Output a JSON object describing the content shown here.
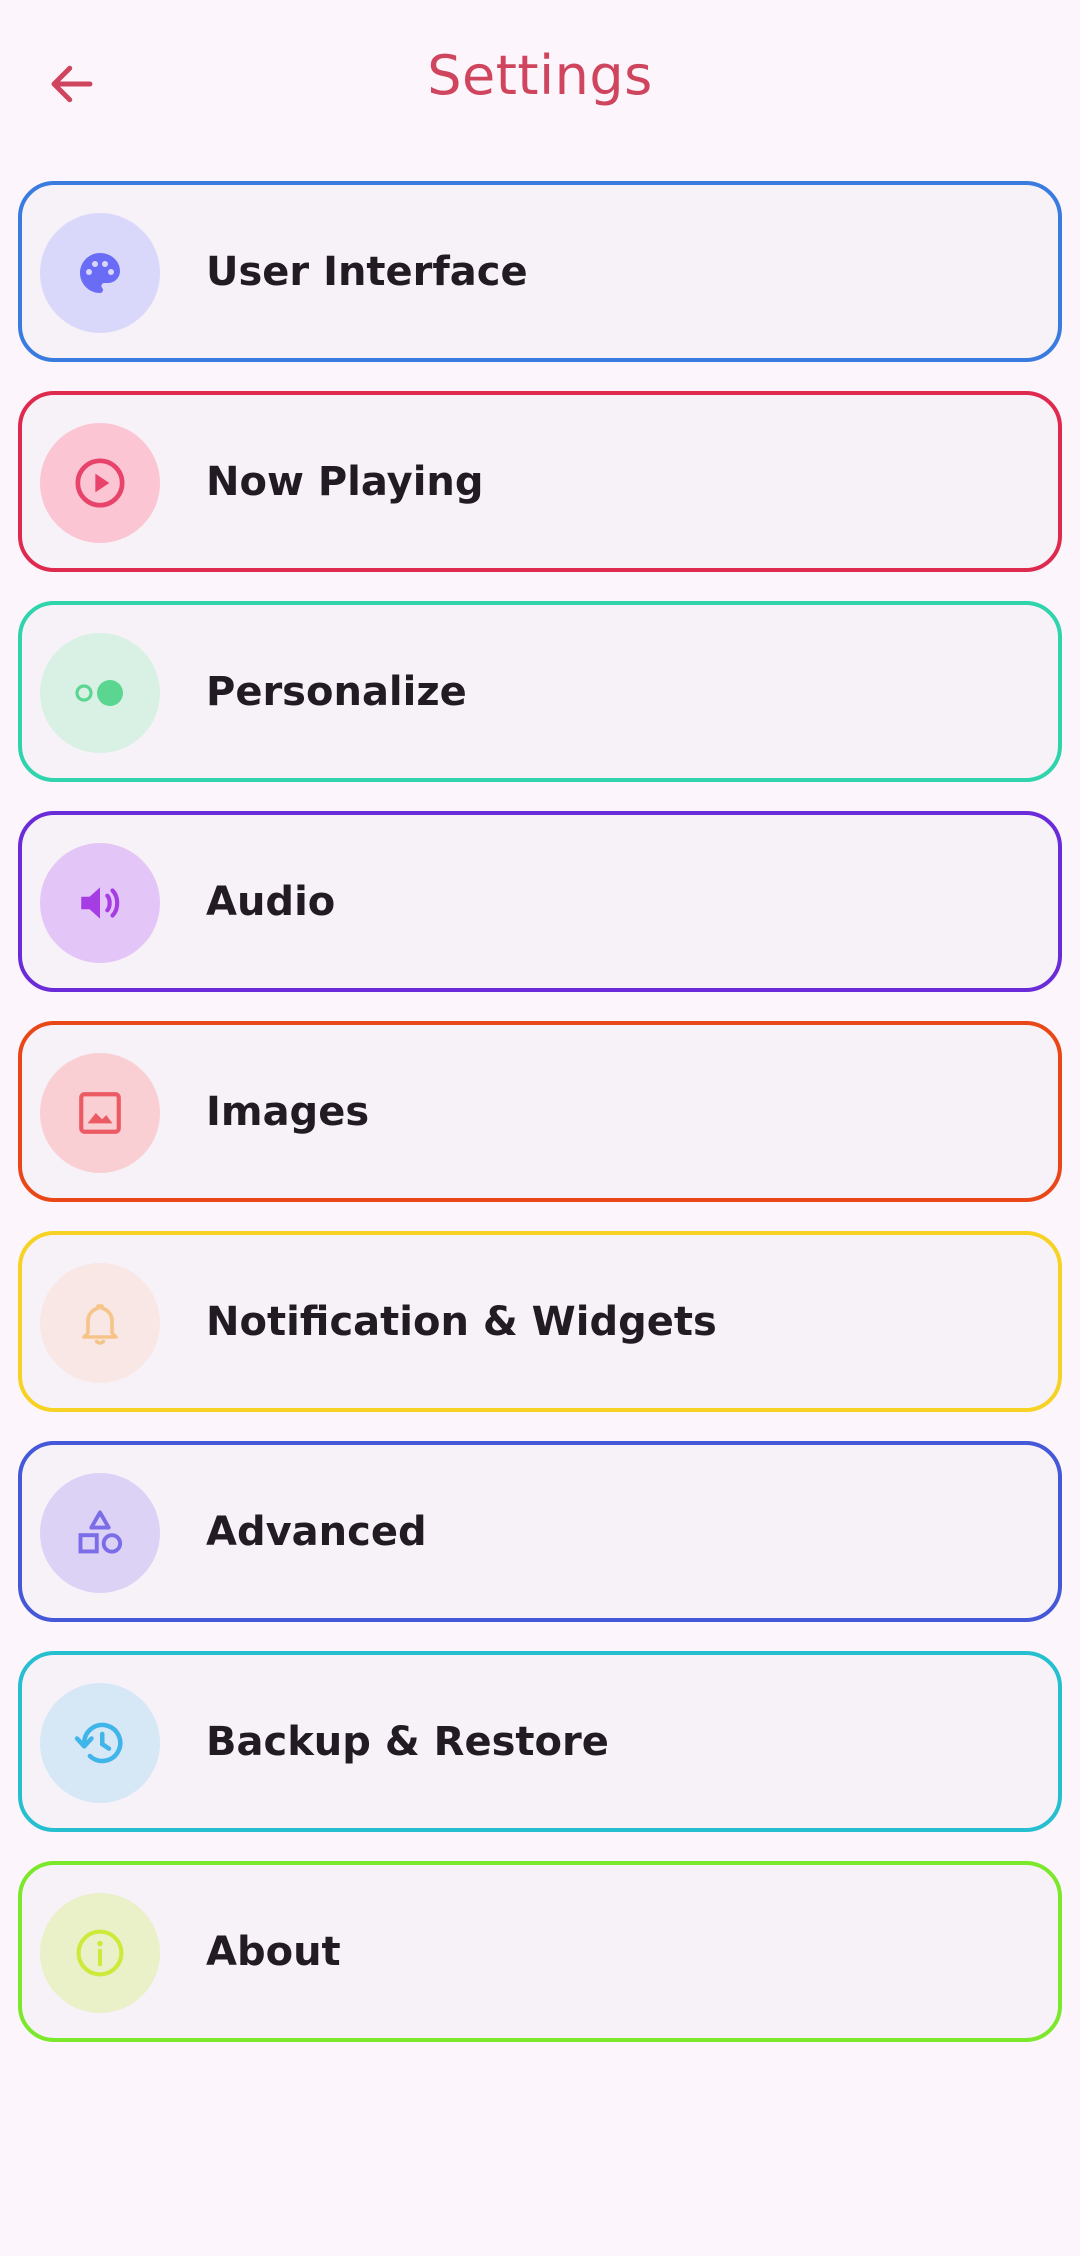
{
  "header": {
    "title": "Settings",
    "back_icon": "arrow-left-icon"
  },
  "colors": {
    "title": "#d0455e",
    "background": "#fcf5fb",
    "card_fill": "#f7f2f8",
    "label_text": "#231b24"
  },
  "items": [
    {
      "label": "User Interface",
      "icon": "palette-icon",
      "border": "#3a7be0",
      "circle": "#d9d8fb",
      "icon_color": "#6b6cf5"
    },
    {
      "label": "Now Playing",
      "icon": "play-circle-icon",
      "border": "#df2a4f",
      "circle": "#fbc5d3",
      "icon_color": "#e8436b"
    },
    {
      "label": "Personalize",
      "icon": "toggle-icon",
      "border": "#2fd4ad",
      "circle": "#d8f1e4",
      "icon_color": "#5ad691"
    },
    {
      "label": "Audio",
      "icon": "volume-icon",
      "border": "#6a2bd8",
      "circle": "#e3c6f7",
      "icon_color": "#a53ce4"
    },
    {
      "label": "Images",
      "icon": "image-icon",
      "border": "#e94718",
      "circle": "#f9cfd4",
      "icon_color": "#ec5b63"
    },
    {
      "label": "Notification & Widgets",
      "icon": "bell-icon",
      "border": "#f5d223",
      "circle": "#f8e7e5",
      "icon_color": "#f6c489"
    },
    {
      "label": "Advanced",
      "icon": "shapes-icon",
      "border": "#4558d8",
      "circle": "#dcd2f6",
      "icon_color": "#7b6ce8"
    },
    {
      "label": "Backup & Restore",
      "icon": "history-icon",
      "border": "#25bfcf",
      "circle": "#d6e7f6",
      "icon_color": "#3fb5e9"
    },
    {
      "label": "About",
      "icon": "info-icon",
      "border": "#7ce82c",
      "circle": "#eaf0c8",
      "icon_color": "#cde93a"
    }
  ]
}
